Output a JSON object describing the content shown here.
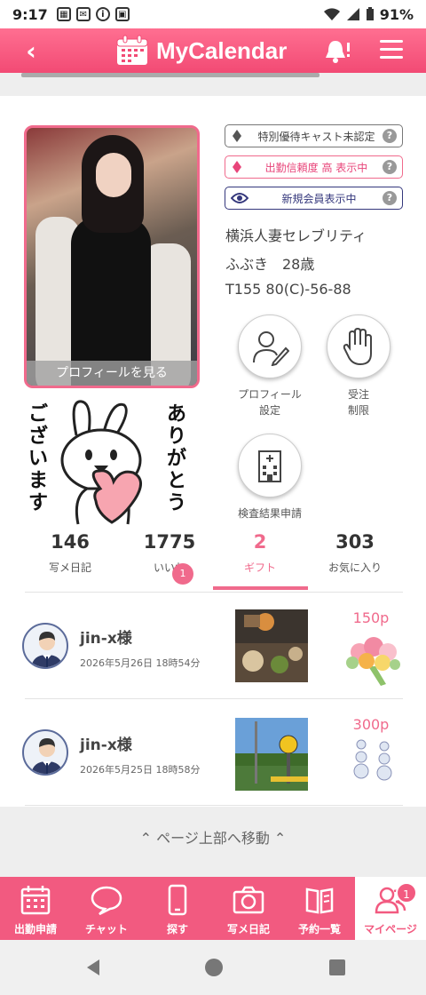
{
  "status_bar": {
    "time": "9:17",
    "battery": "91%"
  },
  "header": {
    "back_label": "‹",
    "title": "MyCalendar"
  },
  "profile": {
    "view_profile_label": "プロフィールを見る",
    "badges": [
      {
        "label": "特別優待キャスト未認定",
        "help": "?"
      },
      {
        "label": "出勤信頼度 高 表示中",
        "help": "?"
      },
      {
        "label": "新規会員表示中",
        "help": "?"
      }
    ],
    "shop_name": "横浜人妻セレブリティ",
    "cast_name_age": "ふぶき　28歳",
    "measurements": "T155 80(C)-56-88"
  },
  "actions": [
    {
      "label_line1": "プロフィール",
      "label_line2": "設定",
      "icon": "profile-edit-icon"
    },
    {
      "label_line1": "受注",
      "label_line2": "制限",
      "icon": "hand-stop-icon"
    },
    {
      "label_line1": "検査結果申請",
      "label_line2": "",
      "icon": "hospital-icon"
    }
  ],
  "stamp": {
    "text_right": "ありがとう",
    "text_left": "ございます"
  },
  "stats": [
    {
      "value": "146",
      "label": "写メ日記"
    },
    {
      "value": "1775",
      "label": "いいね",
      "badge": "1"
    },
    {
      "value": "2",
      "label": "ギフト",
      "active": true
    },
    {
      "value": "303",
      "label": "お気に入り"
    }
  ],
  "gifts": [
    {
      "user": "jin-x様",
      "date": "2026年5月26日 18時54分",
      "points": "150p",
      "gift_icon": "flower-bouquet-icon"
    },
    {
      "user": "jin-x様",
      "date": "2026年5月25日 18時58分",
      "points": "300p",
      "gift_icon": "diamond-earrings-icon"
    }
  ],
  "page_top": "⌃ ページ上部へ移動 ⌃",
  "tabs": [
    {
      "label": "出勤申請",
      "icon": "calendar-icon"
    },
    {
      "label": "チャット",
      "icon": "chat-bubble-icon"
    },
    {
      "label": "探す",
      "icon": "smartphone-icon"
    },
    {
      "label": "写メ日記",
      "icon": "camera-icon"
    },
    {
      "label": "予約一覧",
      "icon": "book-icon"
    },
    {
      "label": "マイページ",
      "icon": "users-icon",
      "badge": "1",
      "active": true
    }
  ],
  "colors": {
    "accent": "#f06a8c",
    "header": "#f24a74",
    "navy": "#34377c"
  }
}
